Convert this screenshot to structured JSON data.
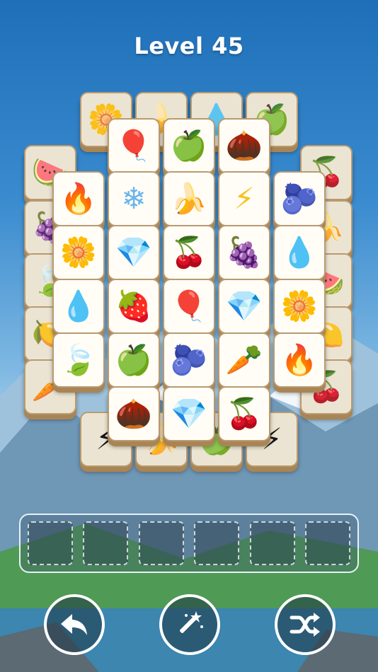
{
  "header": {
    "level_label": "Level 45"
  },
  "icons": {
    "undo": "undo-arrow-icon",
    "magic": "magic-wand-icon",
    "shuffle": "shuffle-icon"
  },
  "tray": {
    "slot_count": 6
  },
  "tiles": {
    "back_row_top": [
      "🌼",
      "🍌",
      "💧",
      "🍏"
    ],
    "back_left_col": [
      "🍉",
      "🍇",
      "🍃",
      "🍋",
      "🥕"
    ],
    "back_right_col": [
      "🍒",
      "🍌",
      "🍉",
      "🍋",
      "🍒"
    ],
    "back_row_bottom": [
      "⚡",
      "🍌",
      "🍏",
      "⚡"
    ],
    "front_row_1": [
      "🎈",
      "🍏",
      "🌰"
    ],
    "front_row_2": [
      "🔥",
      "❄",
      "🍌",
      "⚡",
      "🫐"
    ],
    "front_row_3": [
      "🌼",
      "💎",
      "🍒",
      "🍇",
      "💧"
    ],
    "front_row_4": [
      "💧",
      "🍓",
      "🎈",
      "💎",
      "🌼"
    ],
    "front_row_5": [
      "🍃",
      "🍏",
      "🫐",
      "🥕",
      "🔥"
    ],
    "front_row_6": [
      "🌰",
      "💎",
      "🍒"
    ]
  }
}
